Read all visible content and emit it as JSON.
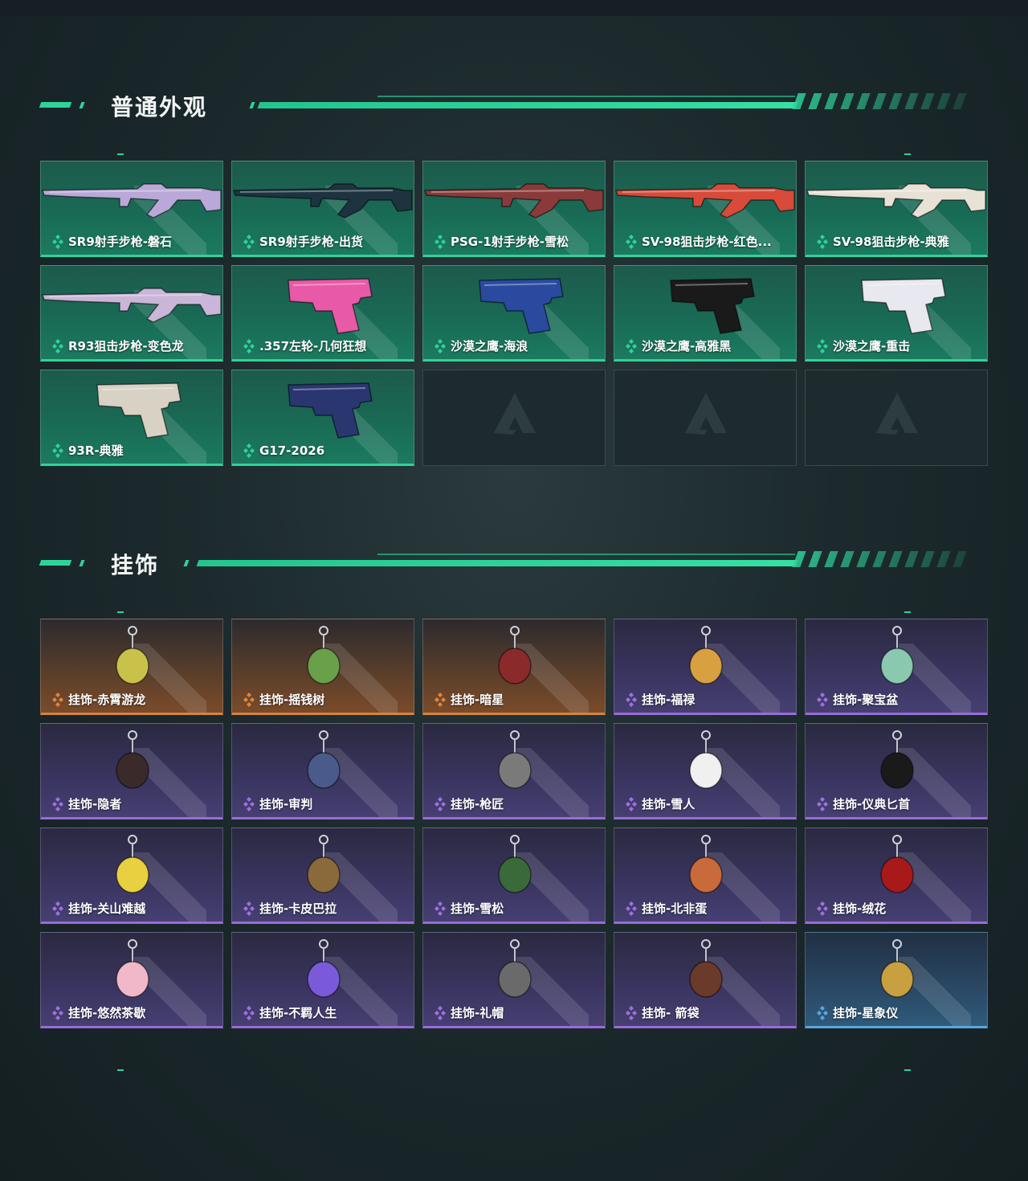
{
  "sections": {
    "skins": {
      "title": "普通外观"
    },
    "charms": {
      "title": "挂饰"
    }
  },
  "skins": [
    {
      "label": "SR9射手步枪-磐石",
      "kind": "rifle",
      "color": "#b9a8d8"
    },
    {
      "label": "SR9射手步枪-出货",
      "kind": "rifle",
      "color": "#1e3340"
    },
    {
      "label": "PSG-1射手步枪-雪松",
      "kind": "rifle",
      "color": "#8a3a3a"
    },
    {
      "label": "SV-98狙击步枪-红色...",
      "kind": "rifle",
      "color": "#d84a3a"
    },
    {
      "label": "SV-98狙击步枪-典雅",
      "kind": "rifle",
      "color": "#e8e2d6"
    },
    {
      "label": "R93狙击步枪-变色龙",
      "kind": "rifle",
      "color": "#c9b6d8"
    },
    {
      "label": ".357左轮-几何狂想",
      "kind": "pistol",
      "color": "#e85aa8"
    },
    {
      "label": "沙漠之鹰-海浪",
      "kind": "pistol",
      "color": "#2a4aa0"
    },
    {
      "label": "沙漠之鹰-高雅黑",
      "kind": "pistol",
      "color": "#1a1a1a"
    },
    {
      "label": "沙漠之鹰-重击",
      "kind": "pistol",
      "color": "#e8e8f0"
    },
    {
      "label": "93R-典雅",
      "kind": "pistol",
      "color": "#d8d2c4"
    },
    {
      "label": "G17-2026",
      "kind": "pistol",
      "color": "#2a3670"
    }
  ],
  "charms": [
    {
      "label": "挂饰-赤霄游龙",
      "rarity": "orange",
      "color": "#c8c24a"
    },
    {
      "label": "挂饰-摇钱树",
      "rarity": "orange",
      "color": "#6aa04a"
    },
    {
      "label": "挂饰-暗星",
      "rarity": "orange",
      "color": "#8a2a2a"
    },
    {
      "label": "挂饰-福禄",
      "rarity": "purple",
      "color": "#d8a040"
    },
    {
      "label": "挂饰-聚宝盆",
      "rarity": "purple",
      "color": "#8ac8b0"
    },
    {
      "label": "挂饰-隐者",
      "rarity": "purple",
      "color": "#3a2a2a"
    },
    {
      "label": "挂饰-审判",
      "rarity": "purple",
      "color": "#4a5a8a"
    },
    {
      "label": "挂饰-枪匠",
      "rarity": "purple",
      "color": "#7a7a7a"
    },
    {
      "label": "挂饰-雪人",
      "rarity": "purple",
      "color": "#f0f0f0"
    },
    {
      "label": "挂饰-仪典匕首",
      "rarity": "purple",
      "color": "#1a1a1a"
    },
    {
      "label": "挂饰-关山难越",
      "rarity": "purple",
      "color": "#e8d040"
    },
    {
      "label": "挂饰-卡皮巴拉",
      "rarity": "purple",
      "color": "#8a6a3a"
    },
    {
      "label": "挂饰-雪松",
      "rarity": "purple",
      "color": "#3a6a3a"
    },
    {
      "label": "挂饰-北非蛋",
      "rarity": "purple",
      "color": "#c86a3a"
    },
    {
      "label": "挂饰-绒花",
      "rarity": "purple",
      "color": "#a81a1a"
    },
    {
      "label": "挂饰-悠然茶歇",
      "rarity": "purple",
      "color": "#f0b8c8"
    },
    {
      "label": "挂饰-不羁人生",
      "rarity": "purple",
      "color": "#7a5ad8"
    },
    {
      "label": "挂饰-礼帽",
      "rarity": "purple",
      "color": "#6a6a6a"
    },
    {
      "label": "挂饰- 箭袋",
      "rarity": "purple",
      "color": "#6a3a2a"
    },
    {
      "label": "挂饰-星象仪",
      "rarity": "blue",
      "color": "#c8a040"
    }
  ],
  "rarity_colors": {
    "green": "#2fd39a",
    "orange": "#e0853e",
    "purple": "#a070e0",
    "blue": "#5aa6e0"
  },
  "icons": {
    "rarity": "diamond-cluster-icon",
    "empty": "logo-triangle-icon"
  }
}
